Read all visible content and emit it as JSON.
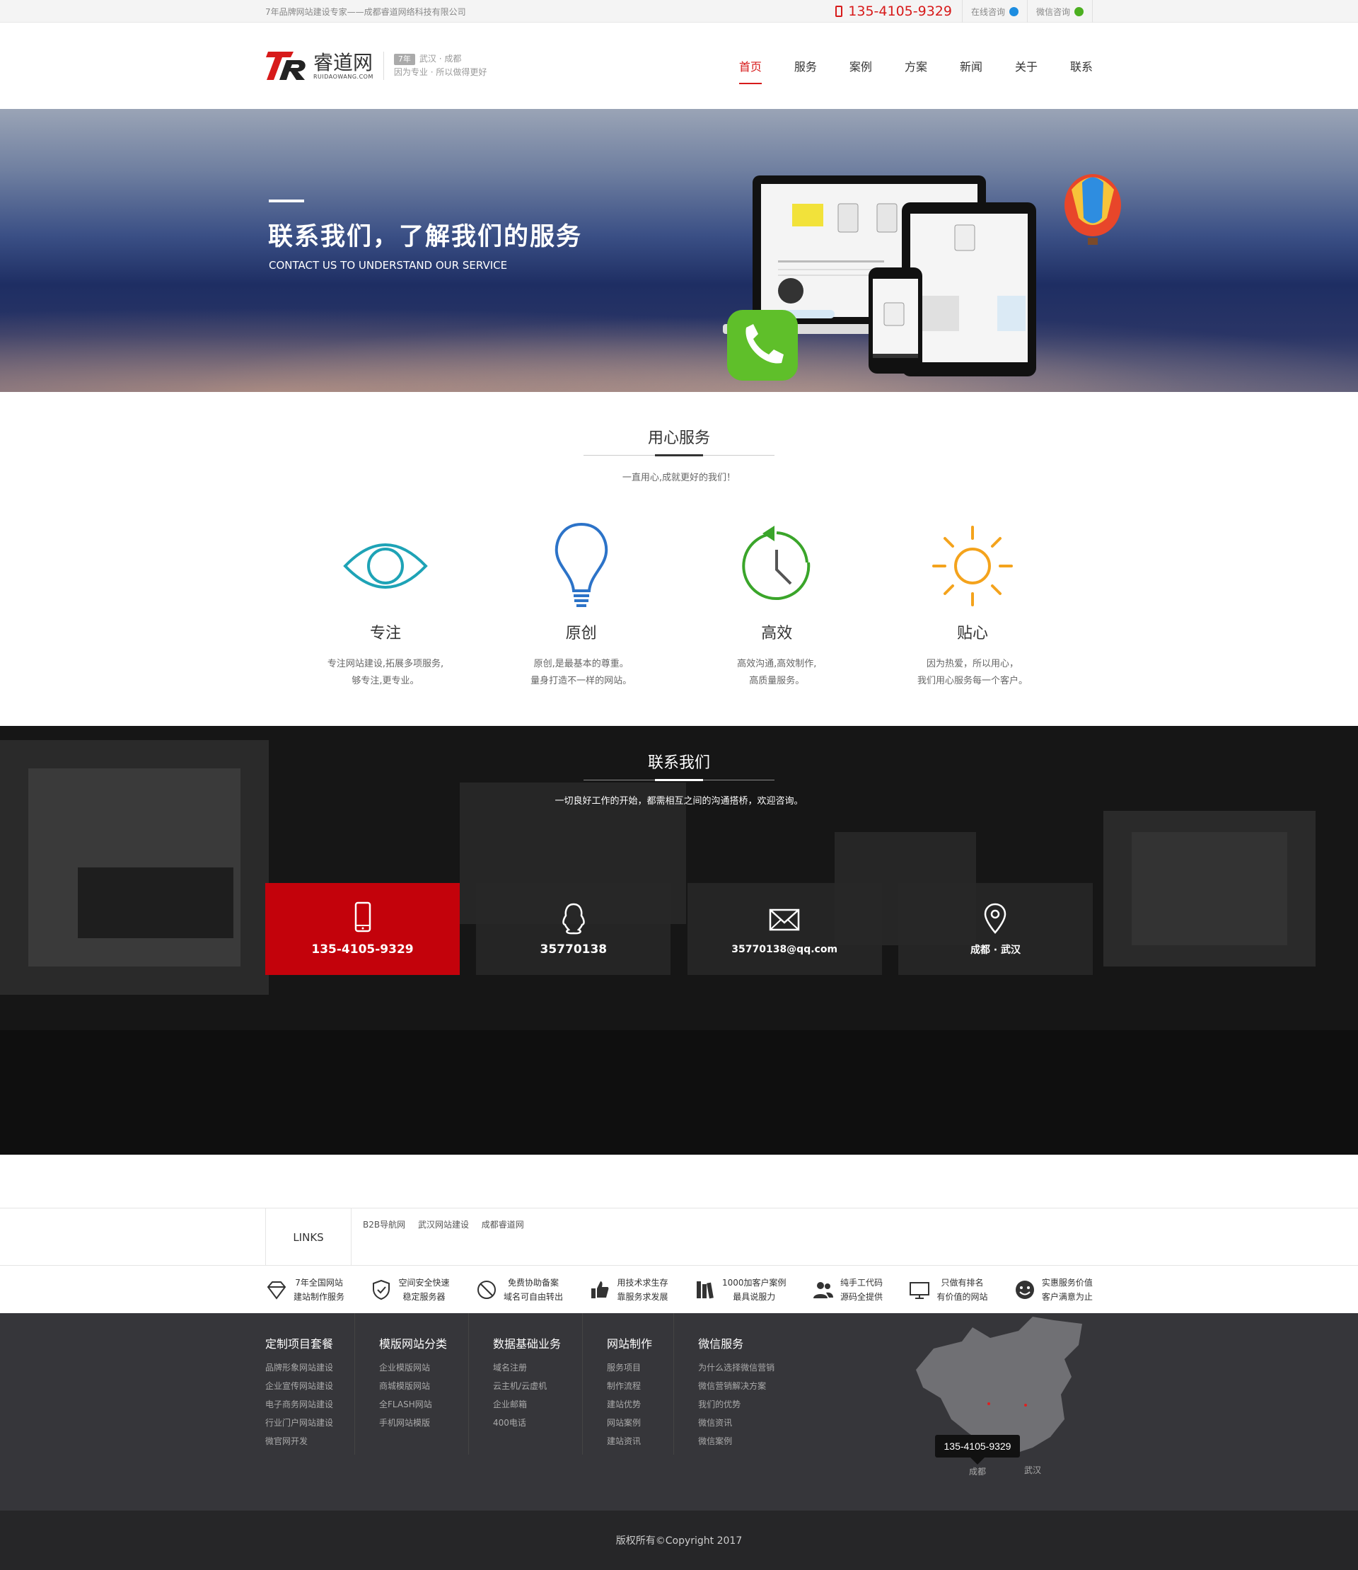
{
  "topbar": {
    "slogan": "7年品牌网站建设专家——成都睿道网络科技有限公司",
    "phone": "135-4105-9329",
    "online": "在线咨询",
    "wechat": "微信咨询"
  },
  "header": {
    "logo_cn": "睿道网",
    "logo_en": "RUIDAOWANG.COM",
    "years": "7年",
    "cities": "武汉 · 成都",
    "motto": "因为专业 · 所以做得更好",
    "nav": [
      "首页",
      "服务",
      "案例",
      "方案",
      "新闻",
      "关于",
      "联系"
    ]
  },
  "banner": {
    "title": "联系我们，了解我们的服务",
    "subtitle": "CONTACT US TO UNDERSTAND OUR SERVICE"
  },
  "service": {
    "title": "用心服务",
    "subtitle": "一直用心,成就更好的我们！",
    "items": [
      {
        "icon": "eye-icon",
        "title": "专注",
        "line1": "专注网站建设,拓展多项服务,",
        "line2": "够专注,更专业。"
      },
      {
        "icon": "lightbulb-icon",
        "title": "原创",
        "line1": "原创,是最基本的尊重。",
        "line2": "量身打造不一样的网站。"
      },
      {
        "icon": "clock-icon",
        "title": "高效",
        "line1": "高效沟通,高效制作,",
        "line2": "高质量服务。"
      },
      {
        "icon": "sun-icon",
        "title": "贴心",
        "line1": "因为热爱，所以用心，",
        "line2": "我们用心服务每一个客户。"
      }
    ]
  },
  "contact": {
    "title": "联系我们",
    "subtitle": "一切良好工作的开始，都需相互之间的沟通搭桥，欢迎咨询。",
    "cards": [
      {
        "icon": "mobile-icon",
        "text": "135-4105-9329"
      },
      {
        "icon": "qq-icon",
        "text": "35770138"
      },
      {
        "icon": "mail-icon",
        "text": "35770138@qq.com"
      },
      {
        "icon": "location-icon",
        "text": "成都 · 武汉"
      }
    ]
  },
  "links": {
    "heading": "LINKS",
    "items": [
      "B2B导航网",
      "武汉网站建设",
      "成都睿道网"
    ]
  },
  "promises": [
    {
      "icon": "diamond-icon",
      "l1": "7年全国网站",
      "l2": "建站制作服务"
    },
    {
      "icon": "shield-icon",
      "l1": "空间安全快速",
      "l2": "稳定服务器"
    },
    {
      "icon": "ban-icon",
      "l1": "免费协助备案",
      "l2": "域名可自由转出"
    },
    {
      "icon": "thumbs-up-icon",
      "l1": "用技术求生存",
      "l2": "靠服务求发展"
    },
    {
      "icon": "books-icon",
      "l1": "1000加客户案例",
      "l2": "最具说服力"
    },
    {
      "icon": "users-icon",
      "l1": "纯手工代码",
      "l2": "源码全提供"
    },
    {
      "icon": "monitor-icon",
      "l1": "只做有排名",
      "l2": "有价值的网站"
    },
    {
      "icon": "smile-icon",
      "l1": "实惠服务价值",
      "l2": "客户满意为止"
    }
  ],
  "footer": {
    "columns": [
      {
        "title": "定制项目套餐",
        "items": [
          "品牌形象网站建设",
          "企业宣传网站建设",
          "电子商务网站建设",
          "行业门户网站建设",
          "微官网开发"
        ]
      },
      {
        "title": "模版网站分类",
        "items": [
          "企业模版网站",
          "商城模版网站",
          "全FLASH网站",
          "手机网站模版"
        ]
      },
      {
        "title": "数据基础业务",
        "items": [
          "域名注册",
          "云主机/云虚机",
          "企业邮箱",
          "400电话"
        ]
      },
      {
        "title": "网站制作",
        "items": [
          "服务项目",
          "制作流程",
          "建站优势",
          "网站案例",
          "建站资讯"
        ]
      },
      {
        "title": "微信服务",
        "items": [
          "为什么选择微信营销",
          "微信营销解决方案",
          "我们的优势",
          "微信资讯",
          "微信案例"
        ]
      }
    ],
    "map_phone": "135-4105-9329",
    "map_city1": "成都",
    "map_city2": "武汉",
    "copyright": "版权所有©Copyright 2017"
  }
}
